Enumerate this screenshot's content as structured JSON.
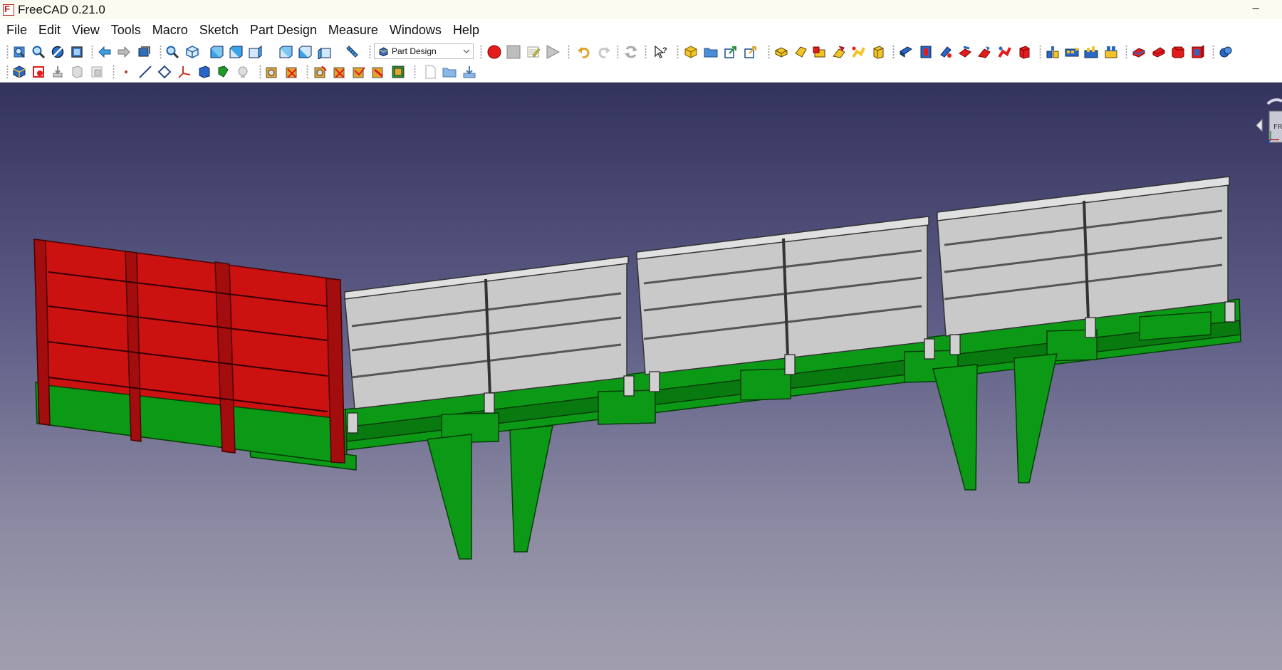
{
  "window": {
    "title": "FreeCAD 0.21.0",
    "minimize_glyph": "–"
  },
  "menu": [
    "File",
    "Edit",
    "View",
    "Tools",
    "Macro",
    "Sketch",
    "Part Design",
    "Measure",
    "Windows",
    "Help"
  ],
  "workbench": {
    "selected": "Part Design"
  },
  "nav_cube": {
    "face_label": "FR"
  },
  "colors": {
    "background_top": "#33335e",
    "background_bottom": "#a19fae",
    "panel_red": "#cc1111",
    "frame_green": "#0c9a16",
    "gate_grey": "#c9c9c9",
    "record_red": "#e41b1b"
  },
  "toolbar_icons_row1": [
    "fit-all-icon",
    "zoom-icon",
    "draw-style-icon",
    "bounding-box-icon",
    "back-arrow-icon",
    "forward-arrow-icon",
    "sync-view-icon",
    "zoom-in-icon",
    "isometric-view-icon",
    "front-view-icon",
    "top-view-icon",
    "right-view-icon",
    "rear-view-icon",
    "bottom-view-icon",
    "left-view-icon",
    "measure-icon",
    "record-macro-icon",
    "stop-macro-icon",
    "edit-macro-icon",
    "run-macro-icon",
    "undo-icon",
    "redo-icon",
    "refresh-icon",
    "whats-this-icon",
    "create-body-icon",
    "open-folder-icon",
    "export-icon",
    "share-icon",
    "pad-icon",
    "revolve-icon",
    "loft-icon",
    "pipe-icon",
    "helix-icon",
    "additive-box-icon",
    "pocket-icon",
    "hole-icon",
    "groove-icon",
    "subtractive-loft-icon",
    "subtractive-pipe-icon",
    "subtractive-helix-icon",
    "subtractive-box-icon",
    "mirrored-icon",
    "linear-pattern-icon",
    "polar-pattern-icon",
    "multi-transform-icon",
    "fillet-icon",
    "chamfer-icon",
    "draft-icon",
    "thickness-icon",
    "boolean-icon"
  ],
  "toolbar_icons_row2": [
    "body-icon",
    "part-icon",
    "sketch-icon",
    "clone-icon",
    "shape-binder-icon",
    "datum-point-icon",
    "datum-line-icon",
    "datum-plane-icon",
    "local-cs-icon",
    "sub-shape-binder-icon",
    "validate-sketch-icon",
    "map-sketch-icon",
    "sketcher-icon",
    "measure-linear-icon",
    "measure-angular-icon",
    "measure-clear-icon",
    "measure-toggle-icon",
    "measure-3d-icon",
    "measure-delta-icon",
    "new-document-icon",
    "open-document-icon",
    "save-document-icon"
  ]
}
